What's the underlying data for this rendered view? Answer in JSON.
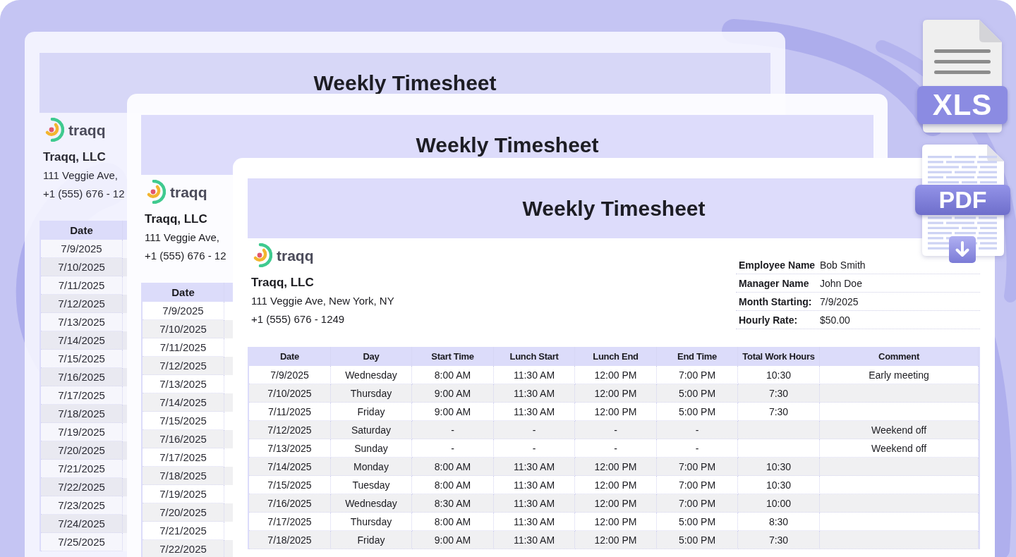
{
  "sheets": [
    {
      "kind": "back",
      "title": "Weekly Timesheet",
      "logo_text": "traqq",
      "company": "Traqq, LLC",
      "address": "111 Veggie Ave,",
      "phone": "+1 (555) 676 - 12",
      "table": {
        "columns": [
          "Date"
        ],
        "rows": [
          {
            "date": "7/9/2025"
          },
          {
            "date": "7/10/2025"
          },
          {
            "date": "7/11/2025"
          },
          {
            "date": "7/12/2025"
          },
          {
            "date": "7/13/2025"
          },
          {
            "date": "7/14/2025"
          },
          {
            "date": "7/15/2025"
          },
          {
            "date": "7/16/2025"
          },
          {
            "date": "7/17/2025"
          },
          {
            "date": "7/18/2025"
          },
          {
            "date": "7/19/2025"
          },
          {
            "date": "7/20/2025"
          },
          {
            "date": "7/21/2025"
          },
          {
            "date": "7/22/2025"
          },
          {
            "date": "7/23/2025"
          },
          {
            "date": "7/24/2025"
          },
          {
            "date": "7/25/2025"
          }
        ]
      }
    },
    {
      "kind": "middle",
      "title": "Weekly Timesheet",
      "logo_text": "traqq",
      "company": "Traqq, LLC",
      "address": "111 Veggie Ave,",
      "phone": "+1 (555) 676 - 12",
      "table": {
        "columns": [
          "Date"
        ],
        "rows": [
          {
            "date": "7/9/2025"
          },
          {
            "date": "7/10/2025"
          },
          {
            "date": "7/11/2025"
          },
          {
            "date": "7/12/2025"
          },
          {
            "date": "7/13/2025"
          },
          {
            "date": "7/14/2025"
          },
          {
            "date": "7/15/2025"
          },
          {
            "date": "7/16/2025"
          },
          {
            "date": "7/17/2025"
          },
          {
            "date": "7/18/2025"
          },
          {
            "date": "7/19/2025"
          },
          {
            "date": "7/20/2025"
          },
          {
            "date": "7/21/2025"
          },
          {
            "date": "7/22/2025"
          }
        ]
      }
    },
    {
      "kind": "front",
      "title": "Weekly Timesheet",
      "logo_text": "traqq",
      "company": "Traqq, LLC",
      "address": "111 Veggie Ave, New York, NY",
      "phone": "+1 (555) 676 - 1249",
      "details": [
        {
          "label": "Employee Name",
          "value": "Bob Smith"
        },
        {
          "label": "Manager Name",
          "value": "John Doe"
        },
        {
          "label": "Month Starting:",
          "value": "7/9/2025"
        },
        {
          "label": "Hourly Rate:",
          "value": "$50.00"
        }
      ],
      "table": {
        "columns": [
          "Date",
          "Day",
          "Start Time",
          "Lunch Start",
          "Lunch End",
          "End Time",
          "Total Work Hours",
          "Comment"
        ],
        "rows": [
          {
            "date": "7/9/2025",
            "day": "Wednesday",
            "start_time": "8:00 AM",
            "lunch_start": "11:30 AM",
            "lunch_end": "12:00 PM",
            "end_time": "7:00 PM",
            "total_work_hours": "10:30",
            "comment": "Early meeting"
          },
          {
            "date": "7/10/2025",
            "day": "Thursday",
            "start_time": "9:00 AM",
            "lunch_start": "11:30 AM",
            "lunch_end": "12:00 PM",
            "end_time": "5:00 PM",
            "total_work_hours": "7:30"
          },
          {
            "date": "7/11/2025",
            "day": "Friday",
            "start_time": "9:00 AM",
            "lunch_start": "11:30 AM",
            "lunch_end": "12:00 PM",
            "end_time": "5:00 PM",
            "total_work_hours": "7:30"
          },
          {
            "date": "7/12/2025",
            "day": "Saturday",
            "start_time": "-",
            "lunch_start": "-",
            "lunch_end": "-",
            "end_time": "-",
            "comment": "Weekend off"
          },
          {
            "date": "7/13/2025",
            "day": "Sunday",
            "start_time": "-",
            "lunch_start": "-",
            "lunch_end": "-",
            "end_time": "-",
            "comment": "Weekend off"
          },
          {
            "date": "7/14/2025",
            "day": "Monday",
            "start_time": "8:00 AM",
            "lunch_start": "11:30 AM",
            "lunch_end": "12:00 PM",
            "end_time": "7:00 PM",
            "total_work_hours": "10:30"
          },
          {
            "date": "7/15/2025",
            "day": "Tuesday",
            "start_time": "8:00 AM",
            "lunch_start": "11:30 AM",
            "lunch_end": "12:00 PM",
            "end_time": "7:00 PM",
            "total_work_hours": "10:30"
          },
          {
            "date": "7/16/2025",
            "day": "Wednesday",
            "start_time": "8:30 AM",
            "lunch_start": "11:30 AM",
            "lunch_end": "12:00 PM",
            "end_time": "7:00 PM",
            "total_work_hours": "10:00"
          },
          {
            "date": "7/17/2025",
            "day": "Thursday",
            "start_time": "8:00 AM",
            "lunch_start": "11:30 AM",
            "lunch_end": "12:00 PM",
            "end_time": "5:00 PM",
            "total_work_hours": "8:30"
          },
          {
            "date": "7/18/2025",
            "day": "Friday",
            "start_time": "9:00 AM",
            "lunch_start": "11:30 AM",
            "lunch_end": "12:00 PM",
            "end_time": "5:00 PM",
            "total_work_hours": "7:30"
          }
        ]
      }
    }
  ],
  "exports": [
    {
      "kind": "spreadsheet",
      "label": "XLS"
    },
    {
      "kind": "pdf",
      "label": "PDF"
    }
  ]
}
